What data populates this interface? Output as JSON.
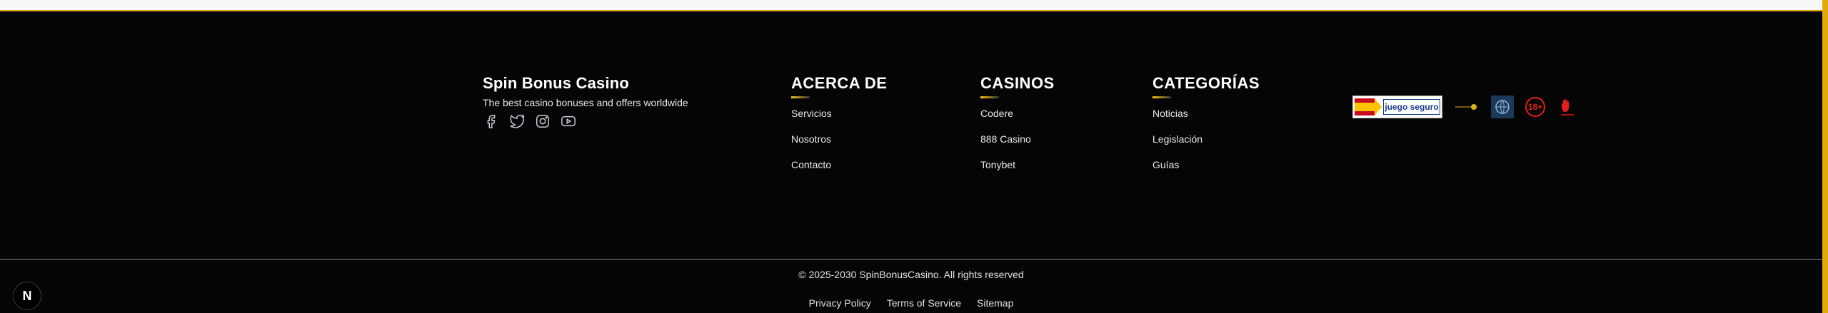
{
  "brand": {
    "name": "Spin Bonus Casino",
    "tagline": "The best casino bonuses and offers worldwide",
    "socials": [
      "facebook-icon",
      "twitter-icon",
      "instagram-icon",
      "youtube-icon"
    ]
  },
  "columns": [
    {
      "title": "ACERCA DE",
      "items": [
        "Servicios",
        "Nosotros",
        "Contacto"
      ]
    },
    {
      "title": "CASINOS",
      "items": [
        "Codere",
        "888 Casino",
        "Tonybet"
      ]
    },
    {
      "title": "CATEGORÍAS",
      "items": [
        "Noticias",
        "Legislación",
        "Guías"
      ]
    }
  ],
  "badges": {
    "juego_seguro": "juego seguro",
    "age": "18+"
  },
  "footer": {
    "copyright": "© 2025-2030 SpinBonusCasino. All rights reserved",
    "links": [
      "Privacy Policy",
      "Terms of Service",
      "Sitemap"
    ]
  },
  "dev_badge": "N",
  "colors": {
    "accent": "#f7c417",
    "background": "#050505",
    "scrollbar": "#e2ab0c"
  }
}
